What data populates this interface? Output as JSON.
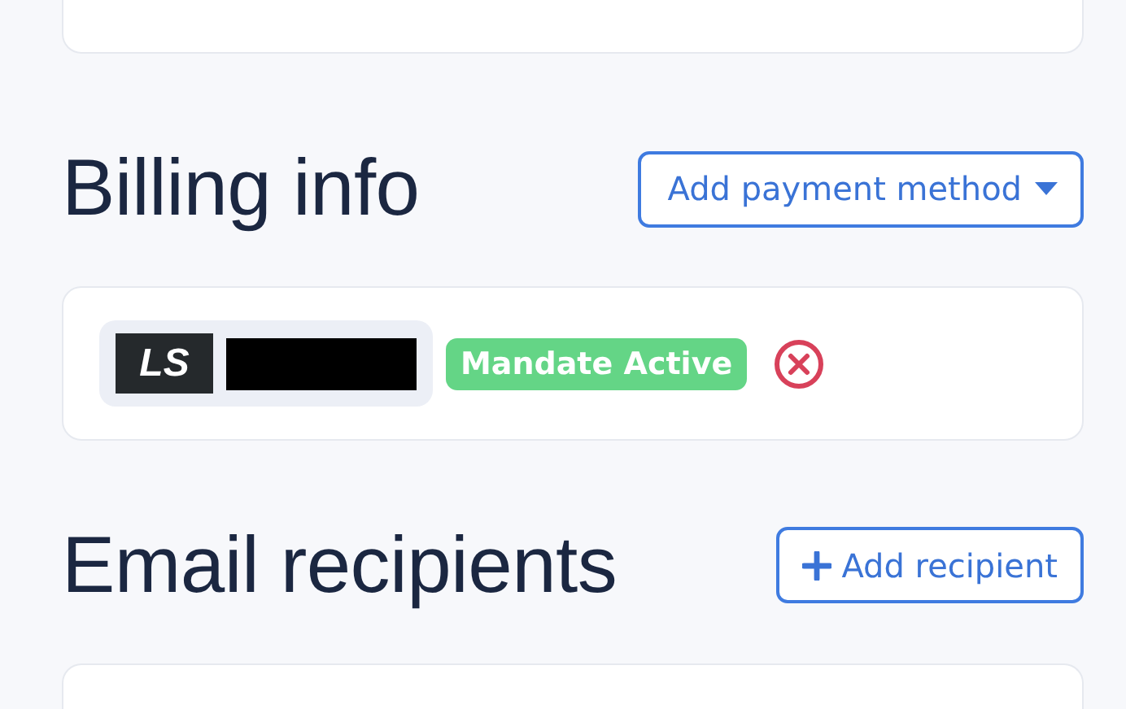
{
  "billing": {
    "title": "Billing info",
    "add_button": {
      "label": "Add payment method",
      "has_menu": true
    },
    "methods": [
      {
        "logo": "LS",
        "name_redacted": true,
        "status": "Mandate Active",
        "active": true
      }
    ]
  },
  "email_recipients": {
    "title": "Email recipients",
    "add_button": {
      "label": "Add recipient"
    }
  }
}
